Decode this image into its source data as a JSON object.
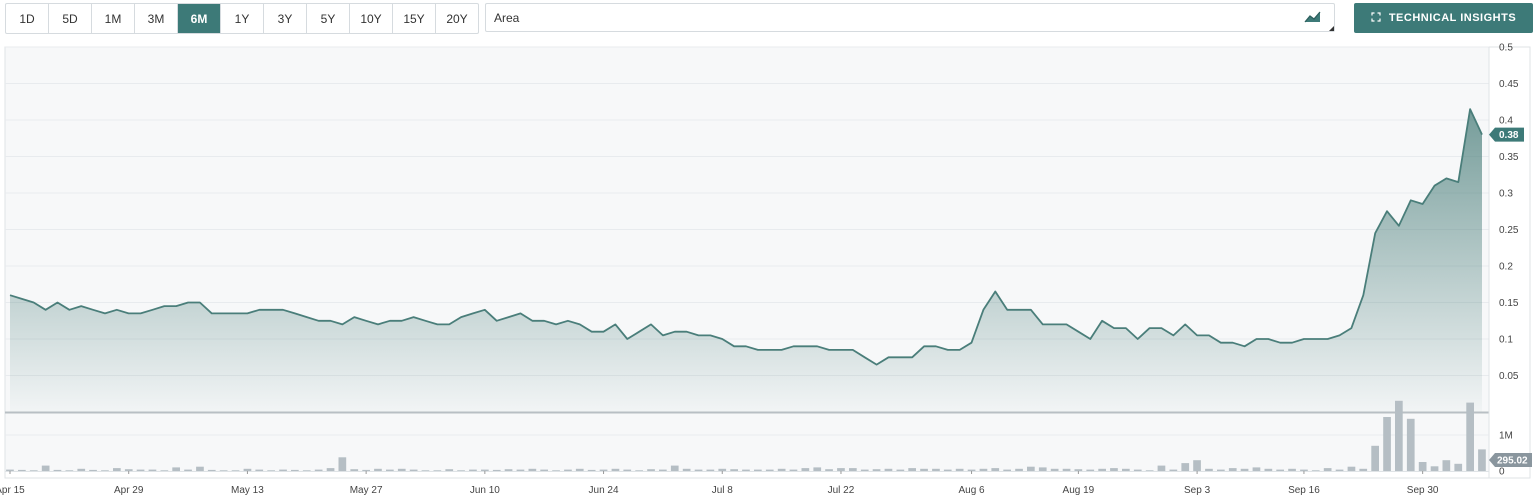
{
  "ranges": [
    {
      "label": "1D"
    },
    {
      "label": "5D"
    },
    {
      "label": "1M"
    },
    {
      "label": "3M"
    },
    {
      "label": "6M"
    },
    {
      "label": "1Y"
    },
    {
      "label": "3Y"
    },
    {
      "label": "5Y"
    },
    {
      "label": "10Y"
    },
    {
      "label": "15Y"
    },
    {
      "label": "20Y"
    }
  ],
  "active_range": "6M",
  "chart_type_select": {
    "value": "Area",
    "icon": "area-chart-icon"
  },
  "technical_insights_button": {
    "label": "TECHNICAL INSIGHTS",
    "icon": "expand-icon"
  },
  "colors": {
    "accent": "#3d7a78",
    "line": "#4a7e7a",
    "volume": "#b5bec4",
    "grid": "#e8ebee",
    "plot_bg": "#f7f8f9"
  },
  "chart_data": {
    "type": "area",
    "price": {
      "ylim": [
        0,
        0.5
      ],
      "ticks": [
        "0.05",
        "0.1",
        "0.15",
        "0.2",
        "0.25",
        "0.3",
        "0.35",
        "0.4",
        "0.45",
        "0.5"
      ],
      "last_value_label": "0.38",
      "values": [
        0.16,
        0.155,
        0.15,
        0.14,
        0.15,
        0.14,
        0.145,
        0.14,
        0.135,
        0.14,
        0.135,
        0.135,
        0.14,
        0.145,
        0.145,
        0.15,
        0.15,
        0.135,
        0.135,
        0.135,
        0.135,
        0.14,
        0.14,
        0.14,
        0.135,
        0.13,
        0.125,
        0.125,
        0.12,
        0.13,
        0.125,
        0.12,
        0.125,
        0.125,
        0.13,
        0.125,
        0.12,
        0.12,
        0.13,
        0.135,
        0.14,
        0.125,
        0.13,
        0.135,
        0.125,
        0.125,
        0.12,
        0.125,
        0.12,
        0.11,
        0.11,
        0.12,
        0.1,
        0.11,
        0.12,
        0.105,
        0.11,
        0.11,
        0.105,
        0.105,
        0.1,
        0.09,
        0.09,
        0.085,
        0.085,
        0.085,
        0.09,
        0.09,
        0.09,
        0.085,
        0.085,
        0.085,
        0.075,
        0.065,
        0.075,
        0.075,
        0.075,
        0.09,
        0.09,
        0.085,
        0.085,
        0.095,
        0.14,
        0.165,
        0.14,
        0.14,
        0.14,
        0.12,
        0.12,
        0.12,
        0.11,
        0.1,
        0.125,
        0.115,
        0.115,
        0.1,
        0.115,
        0.115,
        0.105,
        0.12,
        0.105,
        0.105,
        0.095,
        0.095,
        0.09,
        0.1,
        0.1,
        0.095,
        0.095,
        0.1,
        0.1,
        0.1,
        0.105,
        0.115,
        0.16,
        0.245,
        0.275,
        0.255,
        0.29,
        0.285,
        0.31,
        0.32,
        0.315,
        0.415,
        0.38
      ]
    },
    "volume": {
      "ticks": [
        "0",
        "1M"
      ],
      "vmax": 1500000,
      "last_value_label": "295.02",
      "values": [
        40000,
        30000,
        20000,
        150000,
        30000,
        20000,
        60000,
        30000,
        20000,
        80000,
        50000,
        40000,
        40000,
        20000,
        100000,
        40000,
        120000,
        30000,
        20000,
        20000,
        60000,
        40000,
        20000,
        40000,
        30000,
        20000,
        40000,
        80000,
        380000,
        50000,
        30000,
        60000,
        40000,
        60000,
        40000,
        20000,
        20000,
        50000,
        20000,
        40000,
        40000,
        30000,
        50000,
        40000,
        60000,
        40000,
        20000,
        40000,
        60000,
        30000,
        40000,
        60000,
        40000,
        20000,
        50000,
        40000,
        150000,
        60000,
        40000,
        40000,
        60000,
        50000,
        40000,
        40000,
        40000,
        60000,
        40000,
        80000,
        100000,
        50000,
        80000,
        80000,
        40000,
        50000,
        60000,
        40000,
        80000,
        60000,
        60000,
        40000,
        60000,
        40000,
        60000,
        80000,
        40000,
        60000,
        120000,
        100000,
        60000,
        60000,
        50000,
        40000,
        60000,
        80000,
        60000,
        40000,
        20000,
        150000,
        40000,
        220000,
        300000,
        60000,
        40000,
        80000,
        60000,
        100000,
        60000,
        40000,
        60000,
        40000,
        20000,
        80000,
        40000,
        120000,
        60000,
        700000,
        1500000,
        1950000,
        1450000,
        250000,
        130000,
        300000,
        200000,
        1900000,
        600000
      ]
    },
    "x_labels": [
      {
        "label": "Apr 15",
        "i": 0
      },
      {
        "label": "Apr 29",
        "i": 10
      },
      {
        "label": "May 13",
        "i": 20
      },
      {
        "label": "May 27",
        "i": 30
      },
      {
        "label": "Jun 10",
        "i": 40
      },
      {
        "label": "Jun 24",
        "i": 50
      },
      {
        "label": "Jul 8",
        "i": 60
      },
      {
        "label": "Jul 22",
        "i": 70
      },
      {
        "label": "Aug 6",
        "i": 81
      },
      {
        "label": "Aug 19",
        "i": 90
      },
      {
        "label": "Sep 3",
        "i": 100
      },
      {
        "label": "Sep 16",
        "i": 109
      },
      {
        "label": "Sep 30",
        "i": 119
      }
    ]
  }
}
